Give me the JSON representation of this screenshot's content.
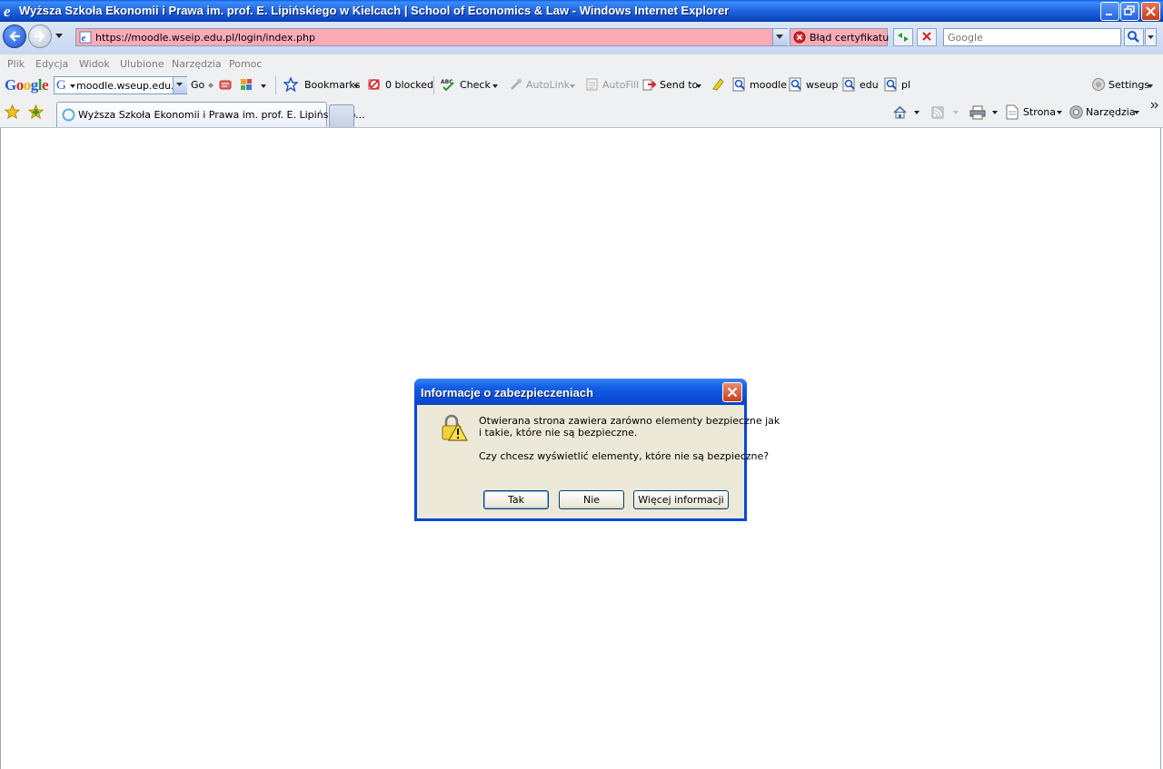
{
  "window": {
    "title": "Wyższa Szkoła Ekonomii i Prawa im. prof. E. Lipińskiego w Kielcach | School of Economics & Law  - Windows Internet Explorer"
  },
  "address_bar": {
    "url": "https://moodle.wseip.edu.pl/login/index.php",
    "certificate_error": "Błąd certyfikatu",
    "search_placeholder": "Google"
  },
  "menu": {
    "items": [
      "Plik",
      "Edycja",
      "Widok",
      "Ulubione",
      "Narzędzia",
      "Pomoc"
    ]
  },
  "google_toolbar": {
    "logo": "Google",
    "search_value": "moodle.wseup.edu.pl",
    "go_label": "Go",
    "bookmarks_label": "Bookmarks",
    "popup_blocked_label": "0 blocked",
    "check_label": "Check",
    "autolink_label": "AutoLink",
    "autofill_label": "AutoFill",
    "sendto_label": "Send to",
    "search_buttons": [
      "moodle",
      "wseup",
      "edu",
      "pl"
    ],
    "settings_label": "Settings"
  },
  "tabs": {
    "active_label": "Wyższa Szkoła Ekonomii i Prawa im. prof. E. Lipińskiego..."
  },
  "command_bar": {
    "page_label": "Strona",
    "tools_label": "Narzędzia"
  },
  "dialog": {
    "title": "Informacje o zabezpieczeniach",
    "message_line1": "Otwierana strona zawiera zarówno elementy bezpieczne jak",
    "message_line2": "i takie, które nie są bezpieczne.",
    "question": "Czy chcesz wyświetlić elementy, które nie są bezpieczne?",
    "yes_label": "Tak",
    "no_label": "Nie",
    "more_info_label": "Więcej informacji"
  },
  "colors": {
    "titlebar_blue": "#0a5ee8",
    "cert_error_pink": "#fbaab6",
    "dialog_face": "#ece9d8"
  }
}
